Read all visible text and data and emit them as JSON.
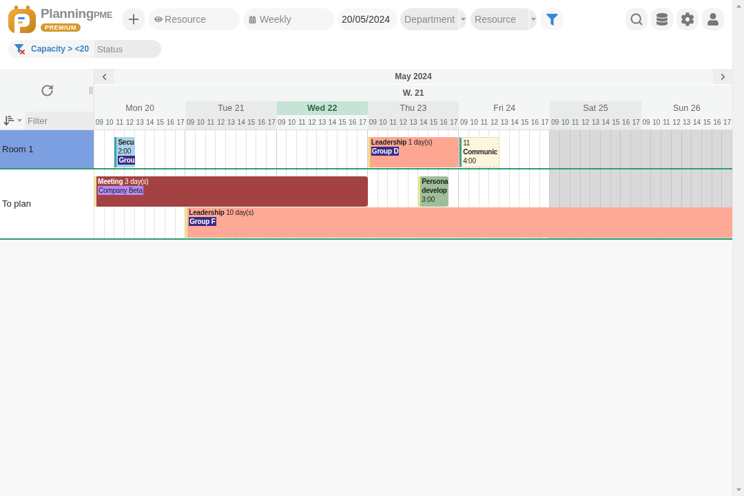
{
  "header": {
    "logo": {
      "wordmark": "Planning",
      "wordmark_suffix": "PME",
      "badge": "PREMIUM"
    },
    "resource_search": {
      "placeholder": "Resource"
    },
    "view": {
      "value": "Weekly"
    },
    "date": {
      "value": "20/05/2024"
    },
    "selects": [
      {
        "placeholder": "Department"
      },
      {
        "placeholder": "Resource"
      }
    ]
  },
  "active_filter": {
    "label": "Capacity > <20",
    "status": {
      "placeholder": "Status"
    }
  },
  "calendar": {
    "month": "May 2024",
    "week": "W. 21",
    "row_filter": {
      "placeholder": "Filter"
    },
    "days": [
      {
        "label": "Mon 20",
        "today": false,
        "weekend": false,
        "hours": [
          "09",
          "10",
          "11",
          "12",
          "13",
          "14",
          "15",
          "16",
          "17"
        ]
      },
      {
        "label": "Tue 21",
        "today": false,
        "weekend": false,
        "hours": [
          "09",
          "10",
          "11",
          "12",
          "13",
          "14",
          "15",
          "16",
          "17"
        ]
      },
      {
        "label": "Wed 22",
        "today": true,
        "weekend": false,
        "hours": [
          "09",
          "10",
          "11",
          "12",
          "13",
          "14",
          "15",
          "16",
          "17"
        ]
      },
      {
        "label": "Thu 23",
        "today": false,
        "weekend": false,
        "hours": [
          "09",
          "10",
          "11",
          "12",
          "13",
          "14",
          "15",
          "16",
          "17"
        ]
      },
      {
        "label": "Fri 24",
        "today": false,
        "weekend": false,
        "hours": [
          "09",
          "10",
          "11",
          "12",
          "13",
          "14",
          "15",
          "16",
          "17"
        ]
      },
      {
        "label": "Sat 25",
        "today": false,
        "weekend": true,
        "hours": [
          "09",
          "10",
          "11",
          "12",
          "13",
          "14",
          "15",
          "16",
          "17"
        ]
      },
      {
        "label": "Sun 26",
        "today": false,
        "weekend": true,
        "hours": [
          "09",
          "10",
          "11",
          "12",
          "13",
          "14",
          "15",
          "16",
          "17"
        ]
      }
    ],
    "rows": [
      {
        "label": "Room 1",
        "selected": true,
        "lanes": [
          [
            {
              "color": "#a9d3eb",
              "dashed": false,
              "stripe": {
                "color": "#3aa6a3"
              },
              "lines": [
                {
                  "kind": "title",
                  "text": "Secu"
                },
                {
                  "kind": "time",
                  "text": "2:00"
                },
                {
                  "kind": "tag",
                  "text": "Grou",
                  "color": "#3c2b88"
                }
              ]
            },
            {
              "color": "#fda692",
              "dashed": false,
              "stripe": {
                "color": "#f1e28c"
              },
              "lines": [
                {
                  "kind": "heading",
                  "text": "**Leadership** 1 day(s)"
                },
                {
                  "kind": "tag",
                  "text": "Group D",
                  "color": "#3c2b88"
                }
              ]
            },
            {
              "color": "#fdf5dc",
              "dashed": true,
              "stripe": {
                "color": "#3aa39b"
              },
              "lines": [
                {
                  "kind": "text",
                  "text": "11"
                },
                {
                  "kind": "title",
                  "text": "Communic"
                },
                {
                  "kind": "time",
                  "text": "4:00"
                }
              ]
            }
          ]
        ]
      },
      {
        "label": "To plan",
        "selected": false,
        "lanes": [
          [
            {
              "color": "#a34242",
              "dashed": false,
              "stripe": {
                "color": "#efe39a"
              },
              "lines": [
                {
                  "kind": "heading",
                  "text": "**Meeting** 3 day(s)"
                },
                {
                  "kind": "tag",
                  "text": "Company Beta",
                  "color": "#b48cf8"
                }
              ]
            },
            {
              "color": "#9dbf98",
              "dashed": false,
              "stripe": {
                "color": "#ede58f"
              },
              "lines": [
                {
                  "kind": "title",
                  "text": "Persona"
                },
                {
                  "kind": "title",
                  "text": "develop"
                },
                {
                  "kind": "time",
                  "text": "3:00"
                }
              ]
            }
          ],
          [
            {
              "color": "#fea995",
              "dashed": false,
              "stripe": {
                "color": "#f0e58c"
              },
              "lines": [
                {
                  "kind": "heading",
                  "text": "**Leadership** 10 day(s)"
                },
                {
                  "kind": "tag",
                  "text": "Group F",
                  "color": "#3c2b88"
                }
              ]
            }
          ]
        ]
      }
    ]
  }
}
